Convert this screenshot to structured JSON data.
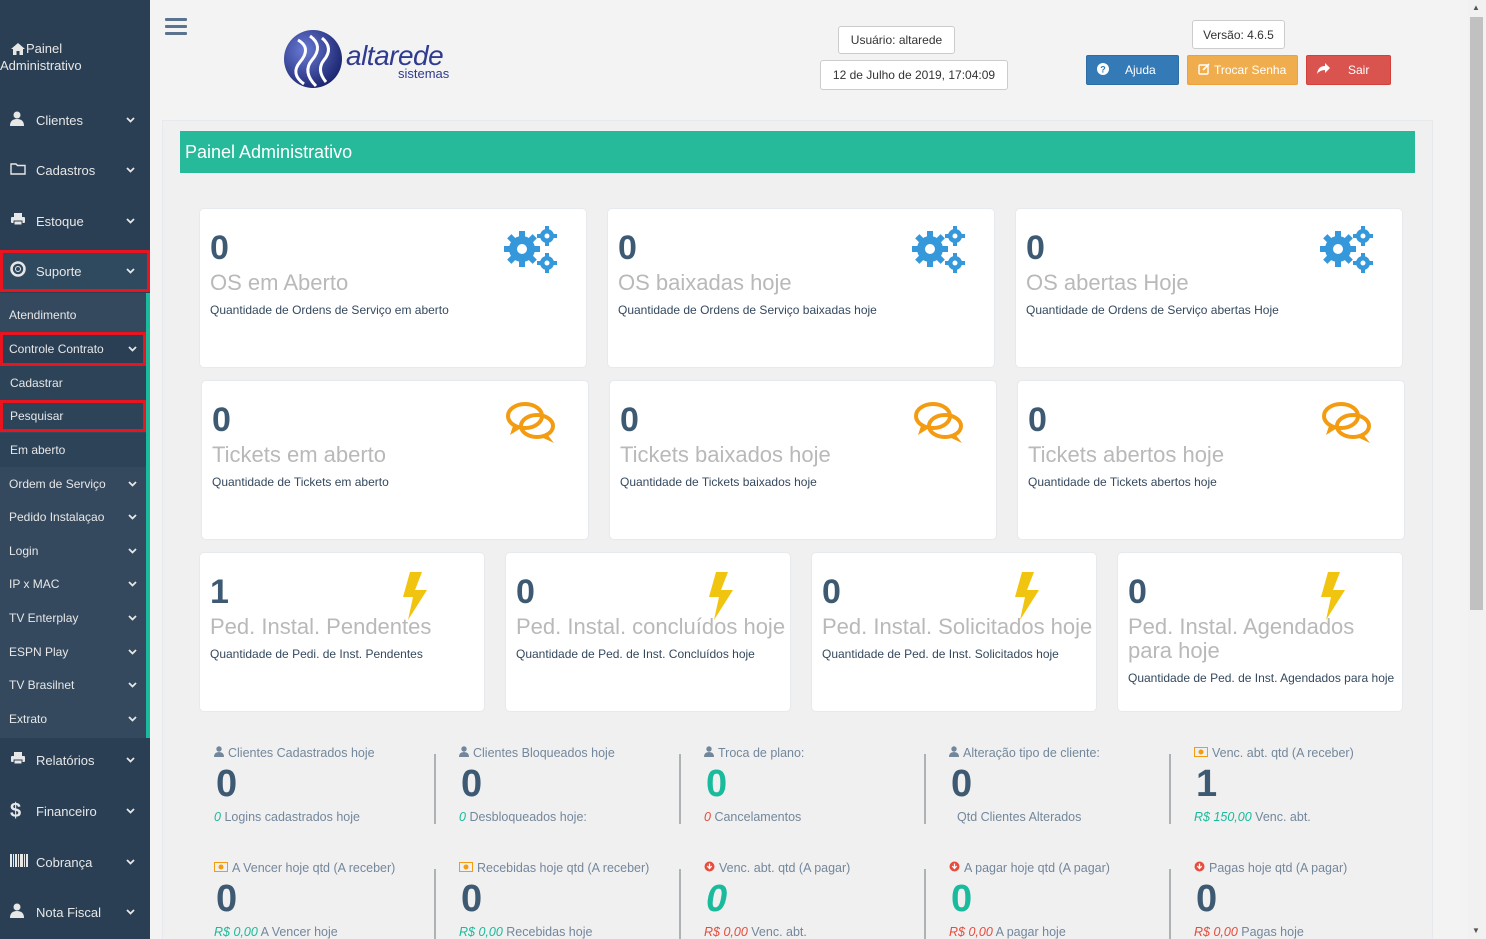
{
  "sidebar": {
    "painel": "Painel Administrativo",
    "painel_line1": "Painel",
    "painel_line2": "Administrativo",
    "items": [
      {
        "label": "Clientes",
        "icon": "user-icon"
      },
      {
        "label": "Cadastros",
        "icon": "folder-icon"
      },
      {
        "label": "Estoque",
        "icon": "printer-icon"
      },
      {
        "label": "Suporte",
        "icon": "life-ring-icon"
      },
      {
        "label": "Relatórios",
        "icon": "printer-icon"
      },
      {
        "label": "Financeiro",
        "icon": "dollar-icon"
      },
      {
        "label": "Cobrança",
        "icon": "barcode-icon"
      },
      {
        "label": "Nota Fiscal",
        "icon": "user-icon"
      }
    ],
    "suporte_sub": [
      {
        "label": "Atendimento"
      },
      {
        "label": "Controle Contrato"
      },
      {
        "label": "Cadastrar"
      },
      {
        "label": "Pesquisar"
      },
      {
        "label": "Em aberto"
      },
      {
        "label": "Ordem de Serviço"
      },
      {
        "label": "Pedido Instalaçao"
      },
      {
        "label": "Login"
      },
      {
        "label": "IP x MAC"
      },
      {
        "label": "TV Enterplay"
      },
      {
        "label": "ESPN Play"
      },
      {
        "label": "TV Brasilnet"
      },
      {
        "label": "Extrato"
      }
    ]
  },
  "header": {
    "logo_text": "altarede",
    "logo_sub": "sistemas",
    "user": "Usuário: altarede",
    "datetime": "12 de Julho de 2019, 17:04:09",
    "version": "Versão: 4.6.5",
    "btn_ajuda": "Ajuda",
    "btn_trocar": "Trocar Senha",
    "btn_sair": "Sair"
  },
  "panel_title": "Painel Administrativo",
  "tiles": [
    {
      "count": "0",
      "title": "OS em Aberto",
      "desc": "Quantidade de Ordens de Serviço em aberto",
      "icon": "gears-icon"
    },
    {
      "count": "0",
      "title": "OS baixadas hoje",
      "desc": "Quantidade de Ordens de Serviço baixadas hoje",
      "icon": "gears-icon"
    },
    {
      "count": "0",
      "title": "OS abertas Hoje",
      "desc": "Quantidade de Ordens de Serviço abertas Hoje",
      "icon": "gears-icon"
    },
    {
      "count": "0",
      "title": "Tickets em aberto",
      "desc": "Quantidade de Tickets em aberto",
      "icon": "comments-icon"
    },
    {
      "count": "0",
      "title": "Tickets baixados hoje",
      "desc": "Quantidade de Tickets baixados hoje",
      "icon": "comments-icon"
    },
    {
      "count": "0",
      "title": "Tickets abertos hoje",
      "desc": "Quantidade de Tickets abertos hoje",
      "icon": "comments-icon"
    },
    {
      "count": "1",
      "title": "Ped. Instal. Pendentes",
      "desc": "Quantidade de Pedi. de Inst. Pendentes",
      "icon": "bolt-icon"
    },
    {
      "count": "0",
      "title": "Ped. Instal. concluídos hoje",
      "desc": "Quantidade de Ped. de Inst. Concluídos hoje",
      "icon": "bolt-icon"
    },
    {
      "count": "0",
      "title": "Ped. Instal. Solicitados hoje",
      "desc": "Quantidade de Ped. de Inst. Solicitados hoje",
      "icon": "bolt-icon"
    },
    {
      "count": "0",
      "title": "Ped. Instal. Agendados para hoje",
      "desc": "Quantidade de Ped. de Inst. Agendados para hoje",
      "icon": "bolt-icon"
    }
  ],
  "stats_row1": [
    {
      "head": "Clientes Cadastrados hoje",
      "icon": "user-icon",
      "value": "0",
      "foot_value": "0",
      "foot_label": "Logins cadastrados hoje"
    },
    {
      "head": "Clientes Bloqueados hoje",
      "icon": "user-icon",
      "value": "0",
      "foot_value": "0",
      "foot_label": "Desbloqueados hoje:"
    },
    {
      "head": "Troca de plano:",
      "icon": "user-icon",
      "value": "0",
      "foot_value": "0",
      "foot_label": "Cancelamentos"
    },
    {
      "head": "Alteração tipo de cliente:",
      "icon": "user-icon",
      "value": "0",
      "foot_value": "",
      "foot_label": "Qtd Clientes Alterados"
    },
    {
      "head": "Venc. abt. qtd (A receber)",
      "icon": "money-icon",
      "value": "1",
      "foot_value": "R$ 150,00",
      "foot_label": "Venc. abt."
    }
  ],
  "stats_row2": [
    {
      "head": "A Vencer hoje qtd (A receber)",
      "icon": "money-icon",
      "value": "0",
      "foot_value": "R$ 0,00",
      "foot_label": "A Vencer hoje"
    },
    {
      "head": "Recebidas hoje qtd (A receber)",
      "icon": "money-icon",
      "value": "0",
      "foot_value": "R$ 0,00",
      "foot_label": "Recebidas hoje"
    },
    {
      "head": "Venc. abt. qtd (A pagar)",
      "icon": "arrow-circle-down-icon",
      "value": "0",
      "foot_value": "R$ 0,00",
      "foot_label": "Venc. abt."
    },
    {
      "head": "A pagar hoje qtd (A pagar)",
      "icon": "arrow-circle-down-icon",
      "value": "0",
      "foot_value": "R$ 0,00",
      "foot_label": "A pagar hoje"
    },
    {
      "head": "Pagas hoje qtd (A pagar)",
      "icon": "arrow-circle-down-icon",
      "value": "0",
      "foot_value": "R$ 0,00",
      "foot_label": "Pagas hoje"
    }
  ],
  "colors": {
    "sidebar": "#2a3f54",
    "accent": "#26b99a",
    "highlight": "#e8141f",
    "gear": "#3498db",
    "comments": "#f39c12",
    "bolt": "#f1c40f"
  }
}
